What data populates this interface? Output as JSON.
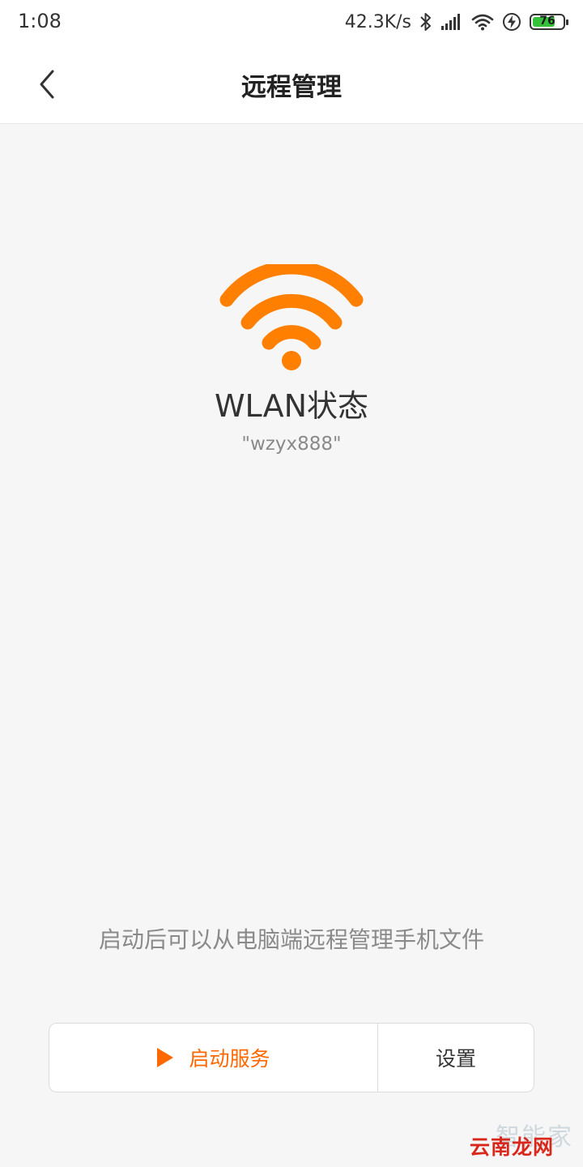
{
  "status_bar": {
    "time": "1:08",
    "net_speed": "42.3K/s",
    "battery_level": "76",
    "icons": [
      "bluetooth-icon",
      "signal-icon",
      "wifi-icon",
      "charging-icon",
      "battery-icon"
    ]
  },
  "nav": {
    "title": "远程管理",
    "back_icon": "chevron-left-icon"
  },
  "main": {
    "wlan_icon": "wifi-icon",
    "wlan_title": "WLAN状态",
    "ssid": "\"wzyx888\"",
    "hint": "启动后可以从电脑端远程管理手机文件"
  },
  "actions": {
    "start_label": "启动服务",
    "start_icon": "play-icon",
    "settings_label": "设置"
  },
  "watermark": {
    "top": "智能家",
    "bottom": "云南龙网"
  },
  "colors": {
    "accent": "#ff6700",
    "background": "#f6f6f6",
    "battery_fill": "#36c13a",
    "watermark_red": "#d9281b"
  }
}
